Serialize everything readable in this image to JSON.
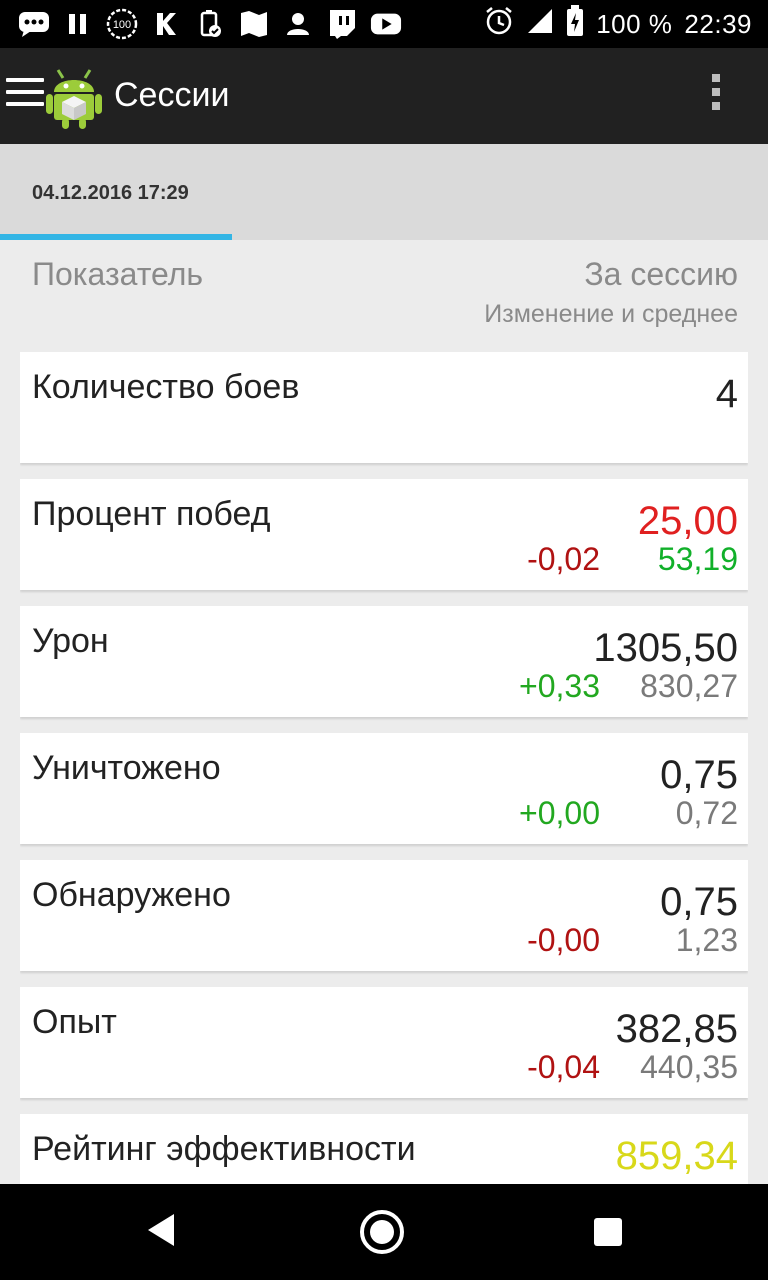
{
  "status": {
    "battery": "100 %",
    "time": "22:39",
    "icons_left": [
      "messages-icon",
      "pause-icon",
      "badge-100-icon",
      "vk-icon",
      "battery-saver-icon",
      "maps-icon",
      "person-icon",
      "twitch-icon",
      "youtube-icon"
    ],
    "icons_right": [
      "alarm-icon",
      "signal-icon",
      "battery-charging-icon"
    ]
  },
  "appbar": {
    "title": "Сессии"
  },
  "tab": {
    "date": "04.12.2016 17:29"
  },
  "header": {
    "left": "Показатель",
    "right": "За сессию",
    "sub": "Изменение и среднее"
  },
  "cards": [
    {
      "label": "Количество боев",
      "main": "4",
      "main_color": "#222222",
      "change": "",
      "change_color": "",
      "avg": ""
    },
    {
      "label": "Процент побед",
      "main": "25,00",
      "main_color": "#e02020",
      "change": "-0,02",
      "change_color": "#b01212",
      "avg": "53,19",
      "avg_color": "#11b02a"
    },
    {
      "label": "Урон",
      "main": "1305,50",
      "main_color": "#222222",
      "change": "+0,33",
      "change_color": "#22a820",
      "avg": "830,27",
      "avg_color": "#7a7a7a"
    },
    {
      "label": "Уничтожено",
      "main": "0,75",
      "main_color": "#222222",
      "change": "+0,00",
      "change_color": "#22a820",
      "avg": "0,72",
      "avg_color": "#7a7a7a"
    },
    {
      "label": "Обнаружено",
      "main": "0,75",
      "main_color": "#222222",
      "change": "-0,00",
      "change_color": "#b01212",
      "avg": "1,23",
      "avg_color": "#7a7a7a"
    },
    {
      "label": "Опыт",
      "main": "382,85",
      "main_color": "#222222",
      "change": "-0,04",
      "change_color": "#b01212",
      "avg": "440,35",
      "avg_color": "#7a7a7a"
    },
    {
      "label": "Рейтинг эффективности",
      "main": "859,34",
      "main_color": "#d8d81a",
      "change": "",
      "change_color": "",
      "avg": ""
    }
  ]
}
